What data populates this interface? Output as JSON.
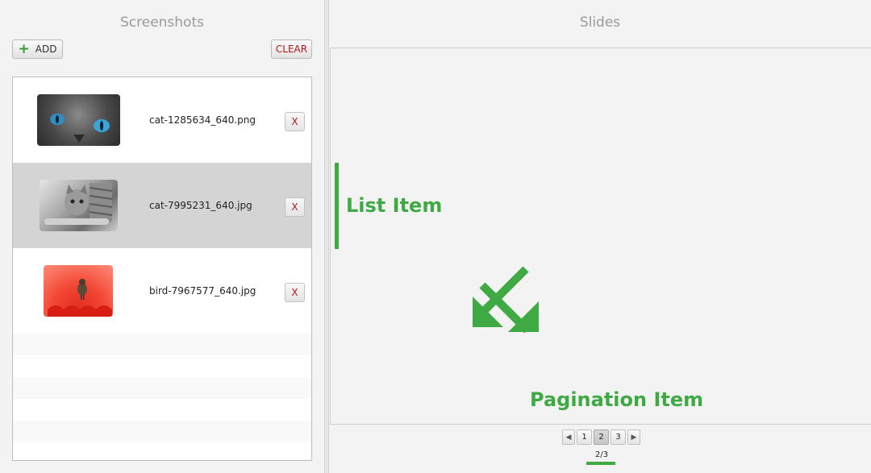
{
  "left_panel": {
    "title": "Screenshots",
    "add_label": "ADD",
    "clear_label": "CLEAR",
    "items": [
      {
        "file_name": "cat-1285634_640.png",
        "remove_label": "X",
        "selected": false
      },
      {
        "file_name": "cat-7995231_640.jpg",
        "remove_label": "X",
        "selected": true
      },
      {
        "file_name": "bird-7967577_640.jpg",
        "remove_label": "X",
        "selected": false
      }
    ]
  },
  "right_panel": {
    "title": "Slides",
    "annotation_list_item": "List Item",
    "annotation_pagination_item": "Pagination Item",
    "pagination": {
      "prev_icon": "triangle-left-icon",
      "next_icon": "triangle-right-icon",
      "pages": [
        "1",
        "2",
        "3"
      ],
      "current_page": "2",
      "indicator": "2/3"
    }
  },
  "colors": {
    "accent_green": "#3fa943",
    "clear_red": "#b01818",
    "selected_row": "#d4d4d4"
  }
}
